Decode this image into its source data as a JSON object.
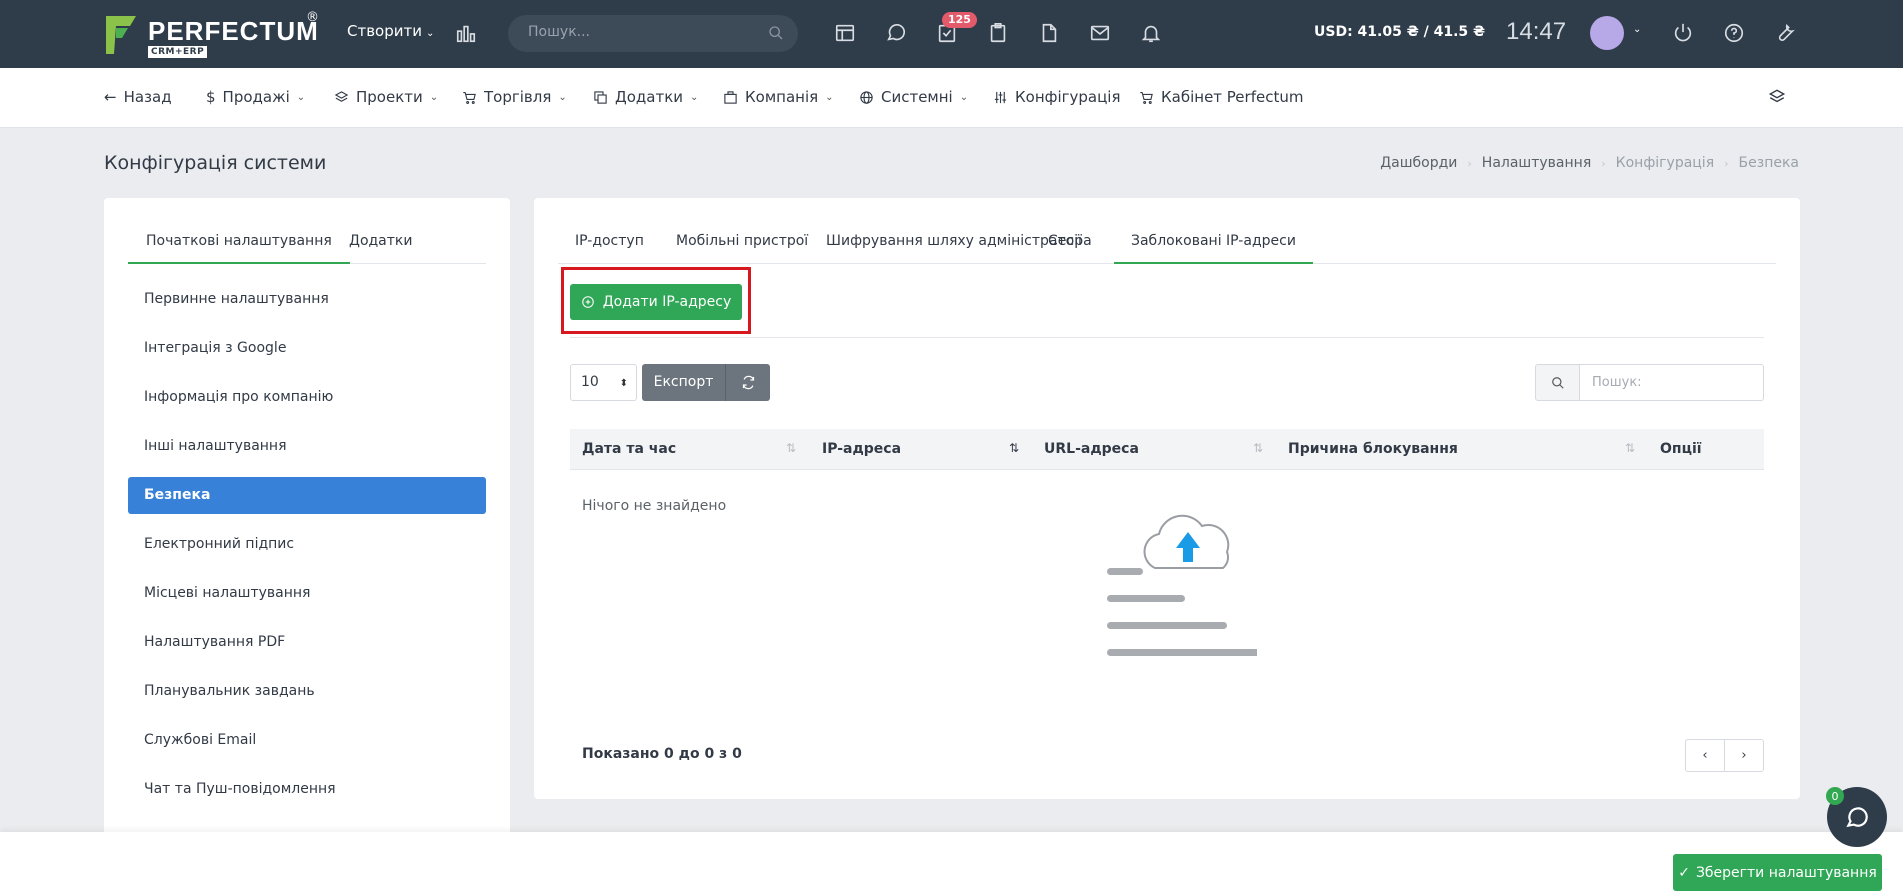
{
  "brand": {
    "name": "PERFECTUM",
    "registered": "®",
    "sub": "CRM+ERP"
  },
  "topbar": {
    "create_label": "Створити",
    "search_placeholder": "Пошук...",
    "tasks_badge": "125",
    "currency": "USD: 41.05 ₴ / 41.5 ₴",
    "clock": "14:47"
  },
  "nav": {
    "back": "Назад",
    "items": [
      {
        "label": "Продажі"
      },
      {
        "label": "Проекти"
      },
      {
        "label": "Торгівля"
      },
      {
        "label": "Додатки"
      },
      {
        "label": "Компанія"
      },
      {
        "label": "Системні"
      },
      {
        "label": "Конфігурація"
      },
      {
        "label": "Кабінет Perfectum"
      }
    ]
  },
  "page": {
    "title": "Конфігурація системи",
    "breadcrumb": [
      "Дашборди",
      "Налаштування",
      "Конфігурація",
      "Безпека"
    ]
  },
  "left": {
    "tabs": [
      "Початкові налаштування",
      "Додатки"
    ],
    "menu": [
      "Первинне налаштування",
      "Інтеграція з Google",
      "Інформація про компанію",
      "Інші налаштування",
      "Безпека",
      "Електронний підпис",
      "Місцеві налаштування",
      "Налаштування PDF",
      "Планувальник завдань",
      "Службові Email",
      "Чат та Пуш-повідомлення"
    ]
  },
  "right": {
    "tabs": [
      "IP-доступ",
      "Мобільні пристрої",
      "Шифрування шляху адміністратора",
      "Сесії",
      "Заблоковані IP-адреси"
    ],
    "add_button": "Додати IP-адресу",
    "per_page": "10",
    "export": "Експорт",
    "search_placeholder": "Пошук:",
    "columns": [
      "Дата та час",
      "IP-адреса",
      "URL-адреса",
      "Причина блокування",
      "Опції"
    ],
    "empty": "Нічого не знайдено",
    "shown": "Показано 0 до 0 з 0",
    "prev": "‹",
    "next": "›"
  },
  "footer": {
    "save": "Зберегти налаштування",
    "chat_badge": "0"
  },
  "colors": {
    "topbar": "#2f3c4a",
    "accent_green": "#2fa756",
    "active_blue": "#3782d8",
    "highlight_red": "#d7191f"
  }
}
